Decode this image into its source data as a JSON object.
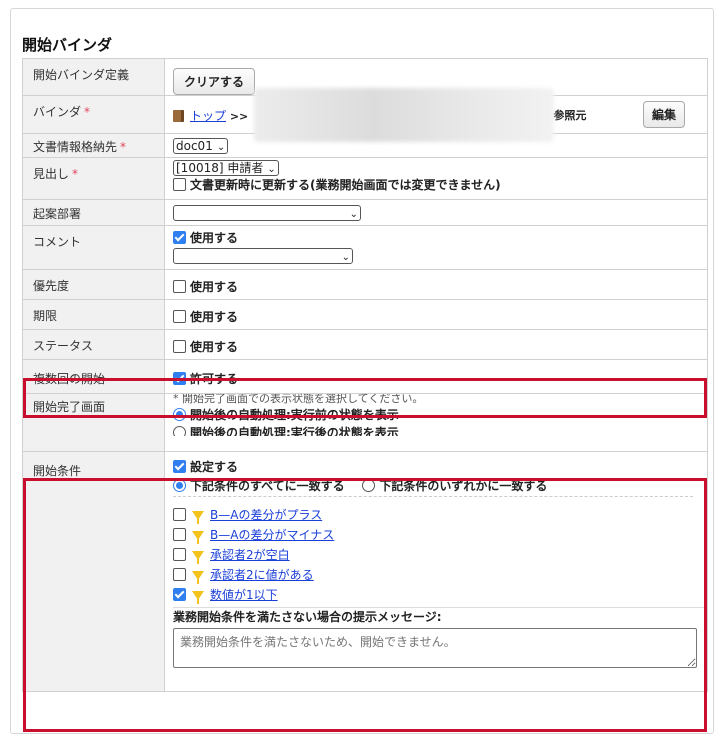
{
  "page_title": "開始バインダ",
  "rows": {
    "definition": {
      "label": "開始バインダ定義",
      "button": "クリアする"
    },
    "binder": {
      "label": "バインダ",
      "required": "*",
      "link": "トップ",
      "sep": ">>",
      "suffix": "› 参照元",
      "edit_button": "編集"
    },
    "doc_store": {
      "label": "文書情報格納先",
      "required": "*",
      "select": "doc01"
    },
    "heading": {
      "label": "見出し",
      "required": "*",
      "select": "[10018] 申請者",
      "checkbox_label": "文書更新時に更新する(業務開始画面では変更できません)",
      "checked": false
    },
    "dept": {
      "label": "起案部署",
      "select": ""
    },
    "comment": {
      "label": "コメント",
      "checkbox_label": "使用する",
      "checked": true,
      "select": ""
    },
    "priority": {
      "label": "優先度",
      "checkbox_label": "使用する",
      "checked": false
    },
    "deadline": {
      "label": "期限",
      "checkbox_label": "使用する",
      "checked": false
    },
    "status": {
      "label": "ステータス",
      "checkbox_label": "使用する",
      "checked": false
    },
    "multiple": {
      "label": "複数回の開始",
      "checkbox_label": "許可する",
      "checked": true
    },
    "complete_screen": {
      "label": "開始完了画面",
      "note": "* 開始完了画面での表示状態を選択してください。",
      "options": [
        "開始後の自動処理:実行前の状態を表示",
        "開始後の自動処理:実行後の状態を表示"
      ],
      "selected": 0
    },
    "start_condition": {
      "label": "開始条件",
      "checkbox_label": "設定する",
      "checked": true,
      "match_options": [
        "下記条件のすべてに一致する",
        "下記条件のいずれかに一致する"
      ],
      "match_selected": 0,
      "conditions": [
        {
          "label": "B—Aの差分がプラス",
          "checked": false
        },
        {
          "label": "B—Aの差分がマイナス",
          "checked": false
        },
        {
          "label": "承認者2が空白",
          "checked": false
        },
        {
          "label": "承認者2に値がある",
          "checked": false
        },
        {
          "label": "数値が1以下",
          "checked": true
        }
      ],
      "message_label": "業務開始条件を満たさない場合の提示メッセージ:",
      "message_placeholder": "業務開始条件を満たさないため、開始できません。"
    }
  },
  "colors": {
    "highlight": "#c8102e",
    "accent": "#2f7ff0",
    "link": "#1a3fd9",
    "funnel": "#f3c21b"
  }
}
